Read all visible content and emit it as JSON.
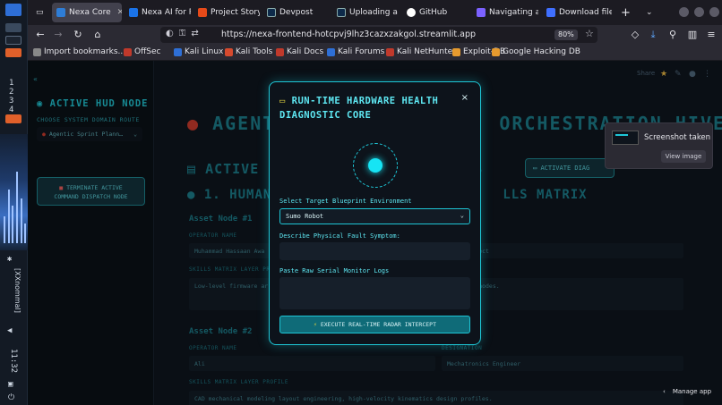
{
  "tabs": [
    {
      "label": "Nexa Core",
      "active": true,
      "color": "#2e7dd6"
    },
    {
      "label": "Nexa AI for Re",
      "active": false,
      "color": "#1a73e8"
    },
    {
      "label": "Project Story",
      "active": false,
      "color": "#e64a19"
    },
    {
      "label": "Devpost",
      "active": false,
      "color": "#0d2a4a"
    },
    {
      "label": "Uploading a d",
      "active": false,
      "color": "#0d2a4a"
    },
    {
      "label": "GitHub",
      "active": false,
      "color": "#ffffff"
    },
    {
      "label": "Navigating a",
      "active": false,
      "color": "#7b61ff"
    },
    {
      "label": "Download file",
      "active": false,
      "color": "#3f6fff"
    }
  ],
  "new_tab": "+",
  "nav": {
    "url": "https://nexa-frontend-hotcpvj9lhz3cazxzakgol.streamlit.app",
    "zoom": "80%"
  },
  "bookmarks": [
    {
      "label": "Import bookmarks...",
      "color": "#888"
    },
    {
      "label": "OffSec",
      "color": "#c0392b"
    },
    {
      "label": "Kali Linux",
      "color": "#2e6fd6"
    },
    {
      "label": "Kali Tools",
      "color": "#d64a2e"
    },
    {
      "label": "Kali Docs",
      "color": "#c0392b"
    },
    {
      "label": "Kali Forums",
      "color": "#2e6fd6"
    },
    {
      "label": "Kali NetHunter",
      "color": "#c0392b"
    },
    {
      "label": "Exploit-DB",
      "color": "#e69a2e"
    },
    {
      "label": "Google Hacking DB",
      "color": "#e69a2e"
    }
  ],
  "sidebar": {
    "title": "ACTIVE HUD NODE",
    "route_label": "CHOOSE SYSTEM DOMAIN ROUTE",
    "route_value": "Agentic Sprint Plann…",
    "terminate_line1": "TERMINATE ACTIVE",
    "terminate_line2": "COMMAND DISPATCH NODE"
  },
  "main": {
    "share": "Share",
    "h1_left": "AGENT",
    "h1_right": "ORCHESTRATION HIVE",
    "h2_left": "ACTIVE",
    "h2_right": "S",
    "activate": "ACTIVATE DIAG",
    "h3_left": "1. HUMAN",
    "h3_right": "LLS MATRIX",
    "assets": [
      {
        "heading": "Asset Node #1",
        "operator_label": "OPERATOR NAME",
        "operator_value": "Muhammad Hassaan Awa",
        "designation_value": "ms Architect",
        "skills_label": "SKILLS MATRIX LAYER PROFILE",
        "skills_value": "Low-level firmware ar",
        "skills_value_right": "nodes."
      },
      {
        "heading": "Asset Node #2",
        "operator_label": "OPERATOR NAME",
        "operator_value": "Ali",
        "designation_label": "DESIGNATION",
        "designation_value": "Mechatronics Engineer",
        "skills_label": "SKILLS MATRIX LAYER PROFILE",
        "skills_value": "CAD mechanical modeling layout engineering, high-velocity kinematics design profiles."
      }
    ]
  },
  "modal": {
    "title": "RUN-TIME HARDWARE HEALTH DIAGNOSTIC CORE",
    "close": "×",
    "blueprint_label": "Select Target Blueprint Environment",
    "blueprint_value": "Sumo Robot",
    "symptom_label": "Describe Physical Fault Symptom:",
    "symptom_value": "",
    "logs_label": "Paste Raw Serial Monitor Logs",
    "logs_value": "",
    "execute": "EXECUTE REAL-TIME RADAR INTERCEPT",
    "accent": "#1ec6d6"
  },
  "notification": {
    "title": "Screenshot taken",
    "action": "View image"
  },
  "footer": {
    "manage": "Manage app"
  },
  "taskbar": {
    "workspaces": "1 2 3 4",
    "user": "[XXnommal]",
    "time": "11:32"
  }
}
